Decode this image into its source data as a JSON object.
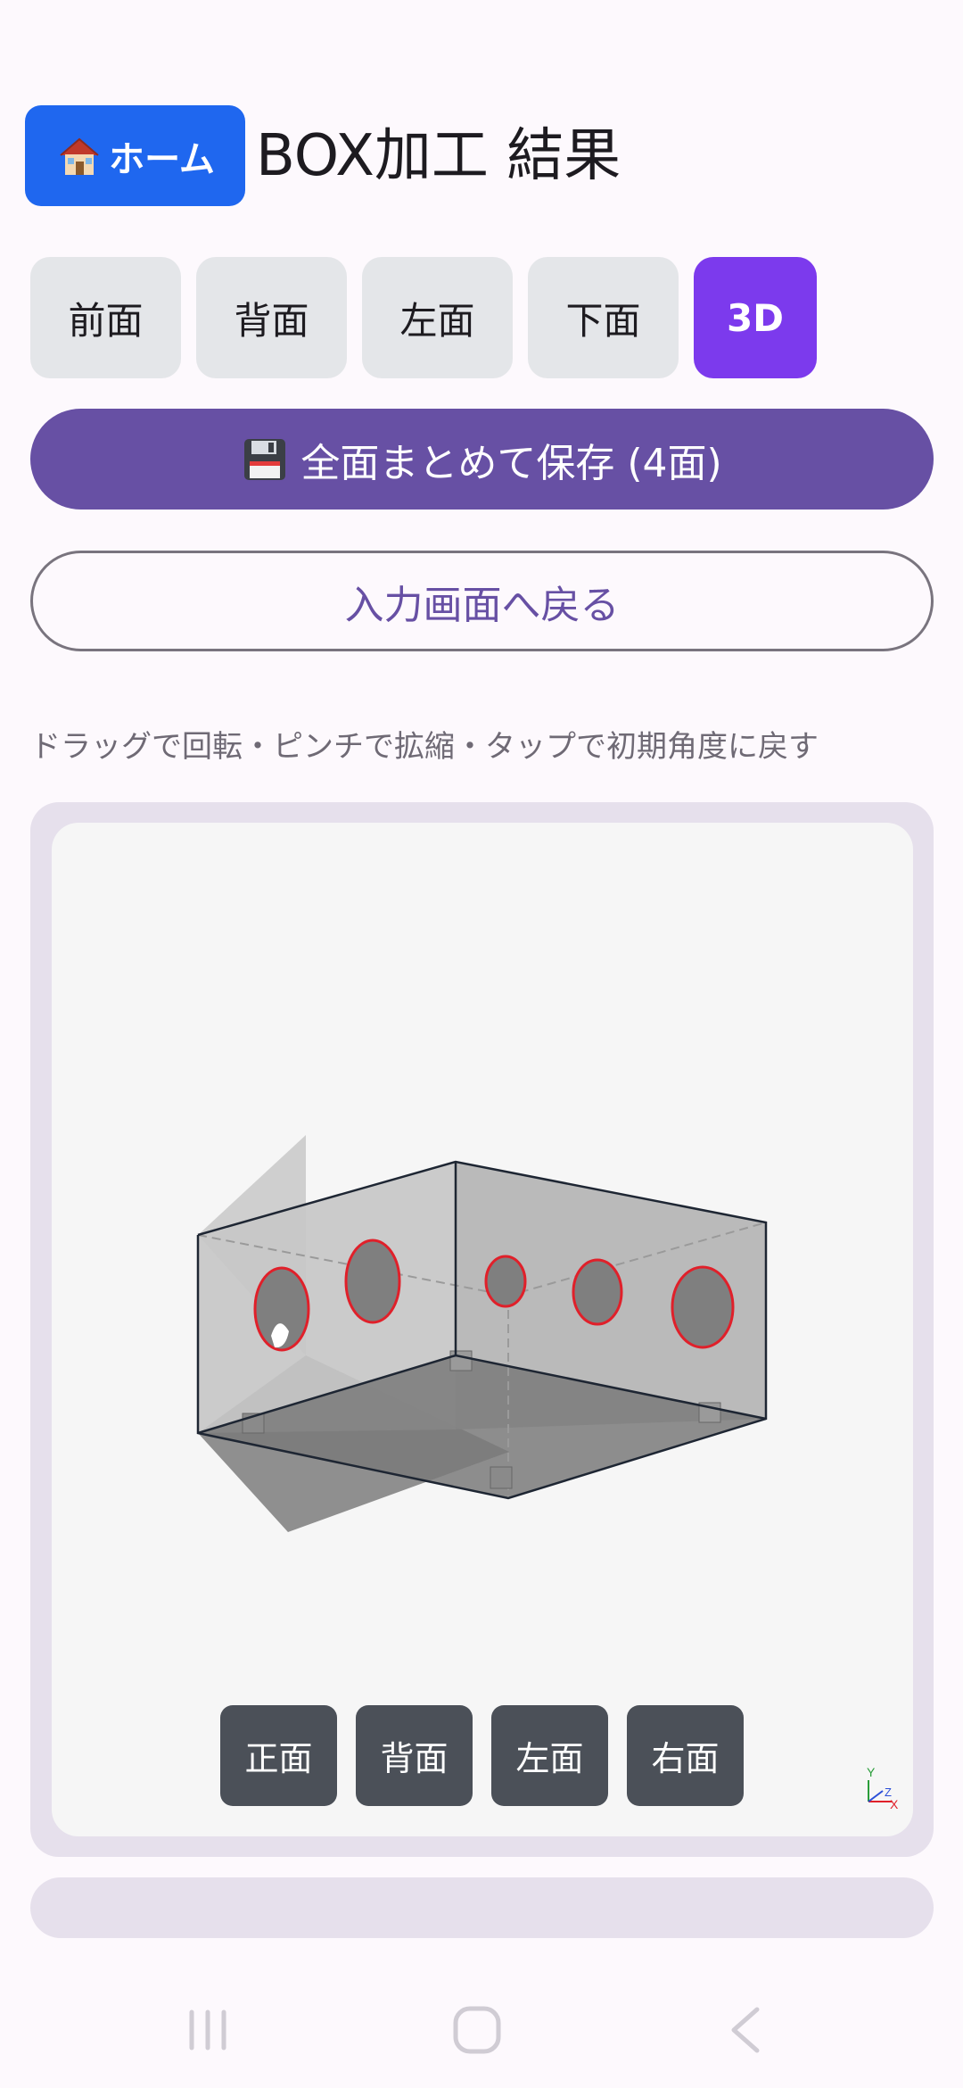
{
  "header": {
    "home_label": "ホーム",
    "title": "BOX加工 結果"
  },
  "tabs": [
    {
      "label": "前面",
      "active": false
    },
    {
      "label": "背面",
      "active": false
    },
    {
      "label": "左面",
      "active": false
    },
    {
      "label": "下面",
      "active": false
    },
    {
      "label": "3D",
      "active": true
    }
  ],
  "actions": {
    "save_all_label": "全面まとめて保存 (4面)",
    "back_label": "入力画面へ戻る"
  },
  "viewer": {
    "hint": "ドラッグで回転・ピンチで拡縮・タップで初期角度に戻す",
    "view_buttons": [
      "正面",
      "背面",
      "左面",
      "右面"
    ],
    "axes": {
      "x": "X",
      "y": "Y",
      "z": "Z"
    }
  },
  "colors": {
    "accent": "#7c3aed",
    "primary": "#6750a4",
    "home": "#1f67ef",
    "hole_outline": "#e0202a"
  },
  "icons": {
    "home": "house-icon",
    "save": "floppy-icon"
  }
}
